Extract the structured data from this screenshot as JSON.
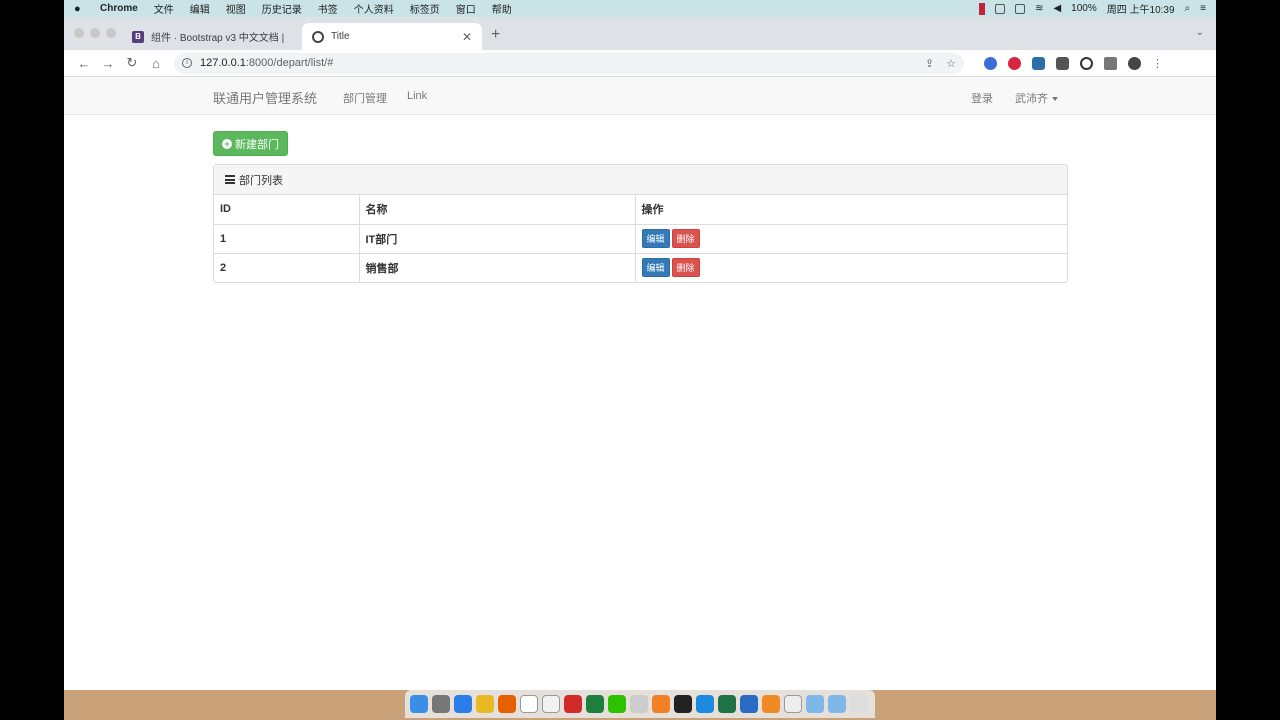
{
  "menubar": {
    "app_name": "Chrome",
    "items": [
      "文件",
      "编辑",
      "视图",
      "历史记录",
      "书签",
      "个人资料",
      "标签页",
      "窗口",
      "帮助"
    ],
    "battery": "100%",
    "datetime": "周四 上午10:39"
  },
  "browser": {
    "tabs": [
      {
        "title": "组件 · Bootstrap v3 中文文档 |",
        "favicon": "bootstrap-icon",
        "active": false
      },
      {
        "title": "Title",
        "favicon": "globe-icon",
        "active": true
      }
    ],
    "new_tab_symbol": "+",
    "url_host": "127.0.0.1",
    "url_path": ":8000/depart/list/#"
  },
  "navbar": {
    "brand": "联通用户管理系统",
    "links": [
      "部门管理",
      "Link"
    ],
    "login": "登录",
    "user": "武沛齐"
  },
  "content": {
    "new_button": "新建部门",
    "panel_title": "部门列表",
    "table": {
      "headers": [
        "ID",
        "名称",
        "操作"
      ],
      "rows": [
        {
          "id": "1",
          "name": "IT部门"
        },
        {
          "id": "2",
          "name": "销售部"
        }
      ],
      "edit_label": "编辑",
      "delete_label": "删除"
    }
  },
  "colors": {
    "success": "#5cb85c",
    "primary": "#337ab7",
    "danger": "#d9534f",
    "navbar_bg": "#f8f8f8"
  }
}
